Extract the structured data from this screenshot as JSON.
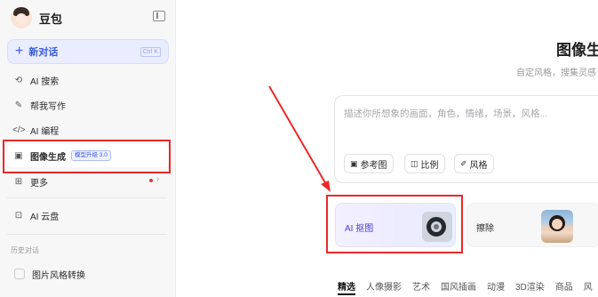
{
  "sidebar": {
    "brand": "豆包",
    "new_chat": "新对话",
    "new_chat_shortcut": "Ctrl K",
    "nav": [
      {
        "label": "AI 搜索",
        "icon": "search-icon"
      },
      {
        "label": "帮我写作",
        "icon": "pen-icon"
      },
      {
        "label": "AI 编程",
        "icon": "code-icon"
      },
      {
        "label": "图像生成",
        "icon": "image-icon",
        "badge": "模型升级 3.0"
      },
      {
        "label": "更多",
        "icon": "grid-icon"
      },
      {
        "label": "AI 云盘",
        "icon": "cloud-drive-icon"
      }
    ],
    "history_title": "历史对话",
    "history": [
      "图片风格转换"
    ]
  },
  "main": {
    "title": "图像生",
    "subtitle": "自定风格，搜集灵感",
    "prompt_placeholder": "描述你所想象的画面，角色，情绪，场景，风格...",
    "chips": [
      "参考图",
      "比例",
      "风格"
    ],
    "tools": [
      {
        "label": "AI 抠图"
      },
      {
        "label": "擦除"
      }
    ],
    "tabs": [
      "精选",
      "人像摄影",
      "艺术",
      "国风插画",
      "动漫",
      "3D渲染",
      "商品",
      "风"
    ]
  },
  "colors": {
    "accent": "#3b5bdb",
    "highlight": "#e82a2a"
  }
}
